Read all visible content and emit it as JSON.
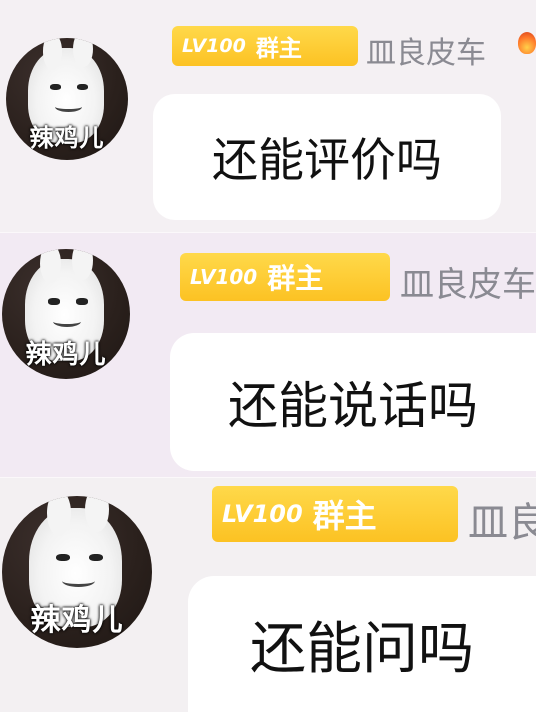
{
  "messages": [
    {
      "avatar_caption": "辣鸡儿",
      "badge_level": "LV100",
      "badge_role": "群主",
      "sender_name": "皿良皮车",
      "text": "还能评价吗"
    },
    {
      "avatar_caption": "辣鸡儿",
      "badge_level": "LV100",
      "badge_role": "群主",
      "sender_name": "皿良皮车",
      "text": "还能说话吗"
    },
    {
      "avatar_caption": "辣鸡儿",
      "badge_level": "LV100",
      "badge_role": "群主",
      "sender_name": "皿良",
      "text": "还能问吗"
    }
  ],
  "icons": {
    "title_decoration": "fire-icon",
    "avatar": "bunny-avatar-icon"
  }
}
